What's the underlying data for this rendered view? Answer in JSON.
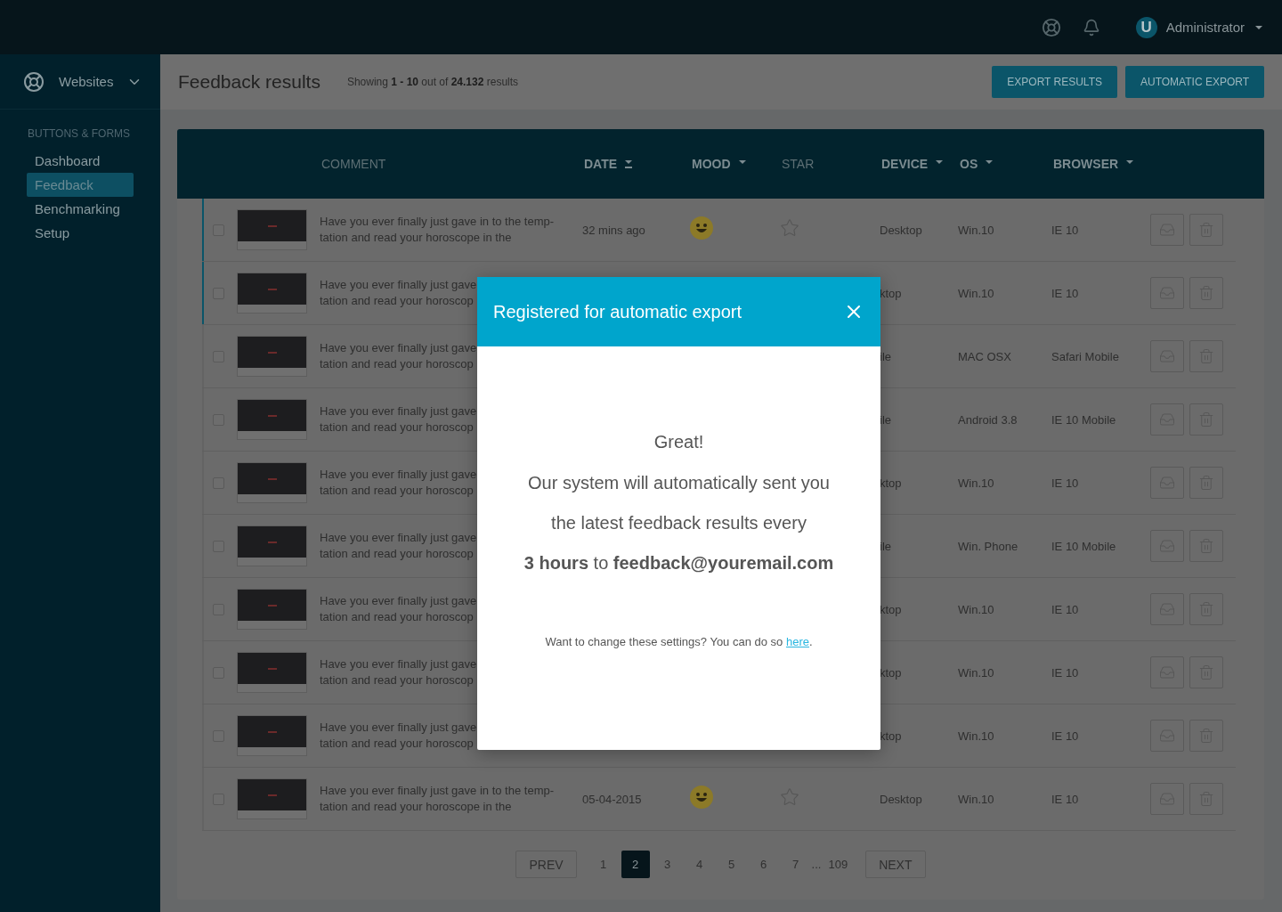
{
  "topbar": {
    "user": {
      "initial": "U",
      "name": "Administrator"
    }
  },
  "sidebar": {
    "switcher": "Websites",
    "section": "BUTTONS & FORMS",
    "items": [
      {
        "label": "Dashboard",
        "selected": false
      },
      {
        "label": "Feedback",
        "selected": true
      },
      {
        "label": "Benchmarking",
        "selected": false
      },
      {
        "label": "Setup",
        "selected": false
      }
    ]
  },
  "header": {
    "title": "Feedback results",
    "summary": "Showing **1 - 10** out of **24.132** results",
    "buttons": [
      "EXPORT RESULTS",
      "AUTOMATIC EXPORT"
    ]
  },
  "table": {
    "columns": [
      {
        "label": "COMMENT",
        "sortable": false
      },
      {
        "label": "DATE",
        "sortable": true,
        "sorted": true
      },
      {
        "label": "MOOD",
        "sortable": true,
        "sorted": false
      },
      {
        "label": "STAR",
        "sortable": false
      },
      {
        "label": "DEVICE",
        "sortable": true,
        "sorted": false
      },
      {
        "label": "OS",
        "sortable": true,
        "sorted": false
      },
      {
        "label": "BROWSER",
        "sortable": true,
        "sorted": false
      }
    ],
    "rows": [
      {
        "selected": true,
        "checked": false,
        "comment": [
          "Have you ever finally just gave in to the temp-",
          "tation and read your horoscope in the"
        ],
        "date": "32 mins ago",
        "mood_icon": true,
        "starred": false,
        "device": "Desktop",
        "os": "Win.10",
        "browser": "IE 10"
      },
      {
        "selected": true,
        "checked": false,
        "comment": [
          "Have you ever finally just gave",
          "tation and read your horoscop"
        ],
        "device": "ktop",
        "os": "Win.10",
        "browser": "IE 10"
      },
      {
        "selected": false,
        "checked": false,
        "comment": [
          "Have you ever finally just gave",
          "tation and read your horoscop"
        ],
        "device": "ile",
        "os": "MAC OSX",
        "browser": "Safari Mobile"
      },
      {
        "selected": false,
        "checked": false,
        "comment": [
          "Have you ever finally just gave",
          "tation and read your horoscop"
        ],
        "device": "ile",
        "os": "Android 3.8",
        "browser": "IE 10 Mobile"
      },
      {
        "selected": false,
        "checked": false,
        "comment": [
          "Have you ever finally just gave",
          "tation and read your horoscop"
        ],
        "device": "ktop",
        "os": "Win.10",
        "browser": "IE 10"
      },
      {
        "selected": false,
        "checked": false,
        "comment": [
          "Have you ever finally just gave",
          "tation and read your horoscop"
        ],
        "device": "ile",
        "os": "Win. Phone",
        "browser": "IE 10 Mobile"
      },
      {
        "selected": false,
        "checked": false,
        "comment": [
          "Have you ever finally just gave",
          "tation and read your horoscop"
        ],
        "device": "ktop",
        "os": "Win.10",
        "browser": "IE 10"
      },
      {
        "selected": false,
        "checked": false,
        "comment": [
          "Have you ever finally just gave",
          "tation and read your horoscop"
        ],
        "device": "ktop",
        "os": "Win.10",
        "browser": "IE 10"
      },
      {
        "selected": false,
        "checked": false,
        "comment": [
          "Have you ever finally just gave",
          "tation and read your horoscop"
        ],
        "device": "ktop",
        "os": "Win.10",
        "browser": "IE 10"
      },
      {
        "selected": false,
        "checked": false,
        "comment": [
          "Have you ever finally just gave in to the temp-",
          "tation and read your horoscope in the"
        ],
        "date": "05-04-2015",
        "mood_icon": true,
        "starred": false,
        "device": "Desktop",
        "os": "Win.10",
        "browser": "IE 10"
      }
    ]
  },
  "pagination": {
    "prev": "PREV",
    "next": "NEXT",
    "pages": [
      {
        "label": "1",
        "selected": false
      },
      {
        "label": "2",
        "selected": true
      },
      {
        "label": "3",
        "selected": false
      },
      {
        "label": "4",
        "selected": false
      },
      {
        "label": "5",
        "selected": false
      },
      {
        "label": "6",
        "selected": false
      },
      {
        "label": "7",
        "selected": false
      }
    ],
    "ellipsis": "...",
    "last": {
      "label": "109",
      "selected": false
    }
  },
  "dialog": {
    "title": "Registered for automatic export",
    "heading": "Great!",
    "message": "Our system will automatically sent you\nthe latest feedback results every\n**3 hours** to **feedback@youremail.com**",
    "note": {
      "before": "Want to change these settings? You can do so ",
      "link": "here",
      "after": "."
    }
  }
}
